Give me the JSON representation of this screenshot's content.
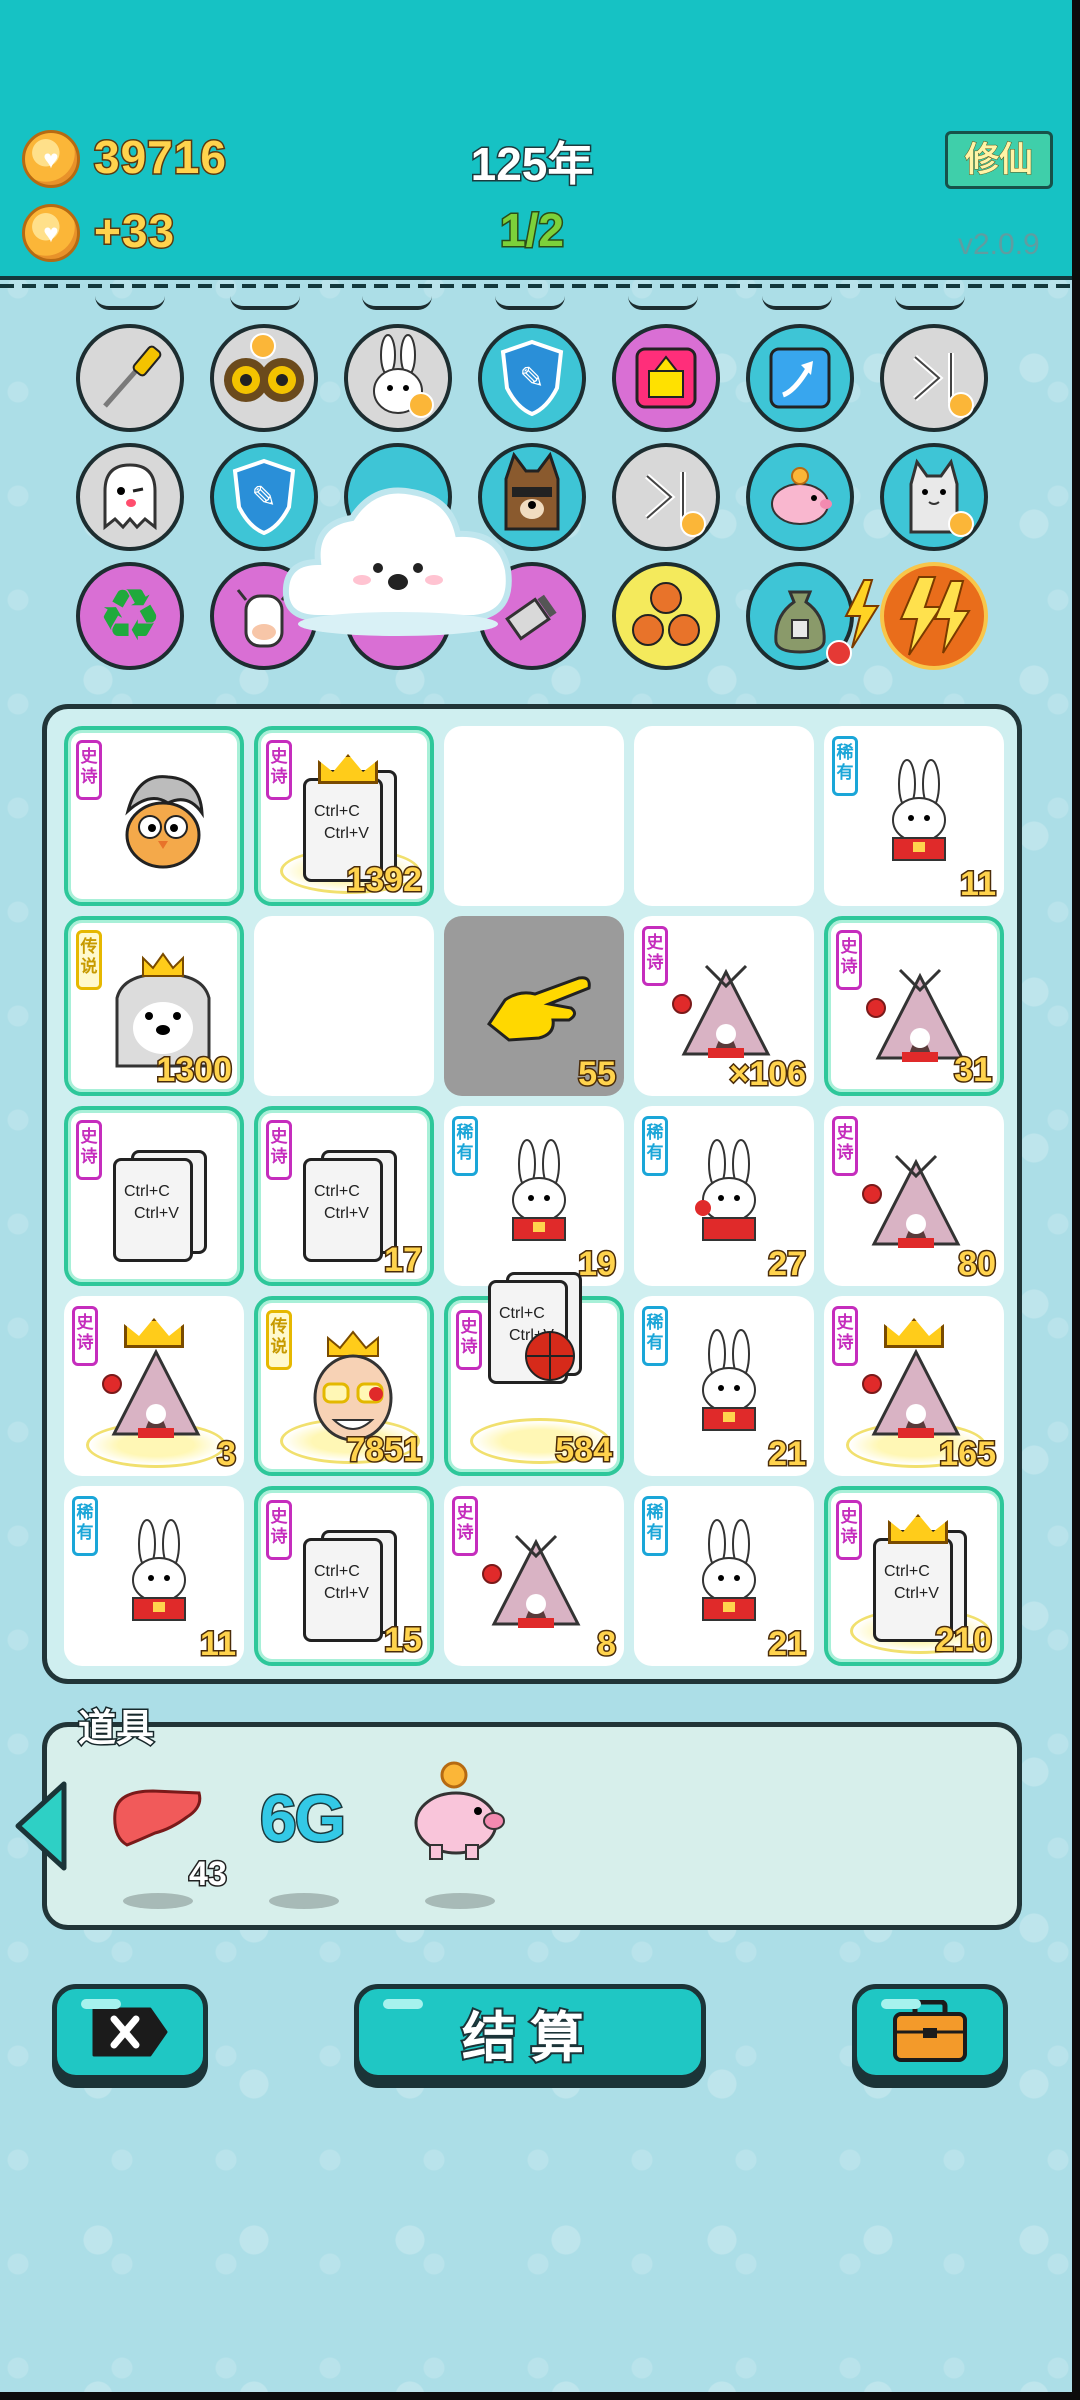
{
  "header": {
    "coins": "39716",
    "income": "+33",
    "year": "125年",
    "progress": "1/2",
    "mode_button": "修仙",
    "version": "v2.0.9"
  },
  "relics": [
    [
      "screwdriver-icon",
      "owl-icon",
      "bunny-icon",
      "shield-wrench-icon",
      "alarm-icon",
      "arrow-up-icon",
      "skip-icon"
    ],
    [
      "ghost-icon",
      "shield-wrench-icon",
      "cloud-icon",
      "husky-icon",
      "skip-icon",
      "piggy-bank-icon",
      "cat-icon"
    ],
    [
      "recycle-icon",
      "cow-icon",
      "cloud-icon",
      "cleaver-icon",
      "basketball-icon",
      "money-bag-icon",
      "lightning-icon"
    ]
  ],
  "tags": {
    "epic": "史诗",
    "rare": "稀有",
    "legend": "传说"
  },
  "board": {
    "r0": {
      "c1": "1392",
      "c4": "11"
    },
    "r1": {
      "c0": "1300",
      "c2": "55",
      "c3": "×106",
      "c4": "31"
    },
    "r2": {
      "c1": "17",
      "c2": "19",
      "c3": "27",
      "c4": "80"
    },
    "r3": {
      "c0": "3",
      "c1": "7851",
      "c2": "584",
      "c3": "21",
      "c4": "165"
    },
    "r4": {
      "c0": "11",
      "c1": "15",
      "c2": "8",
      "c3": "21",
      "c4": "210"
    }
  },
  "card_text": {
    "line1": "Ctrl+C",
    "line2": "Ctrl+V"
  },
  "items": {
    "label": "道具",
    "liver_count": "43",
    "sixg": "6G"
  },
  "buttons": {
    "settle": "结算"
  },
  "colors": {
    "header": "#16c2c4",
    "background": "#a8dde6",
    "epic_border": "#2ec79a",
    "epic_tag": "#c52dbd",
    "rare_tag": "#1aa6d8",
    "count_text": "#ffd34d"
  }
}
